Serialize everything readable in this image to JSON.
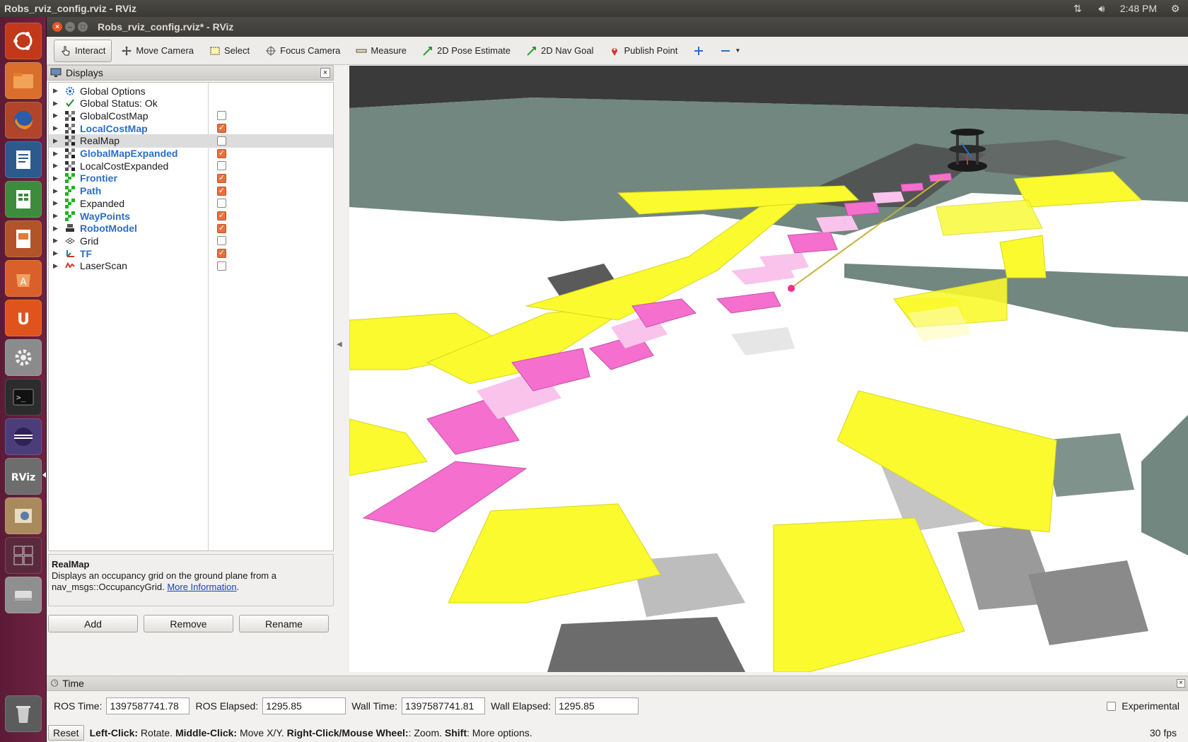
{
  "top_panel": {
    "title": "Robs_rviz_config.rviz - RViz",
    "time": "2:48 PM"
  },
  "launcher": {
    "icons": [
      "ubuntu-logo-icon",
      "files-icon",
      "firefox-icon",
      "writer-icon",
      "calc-icon",
      "impress-icon",
      "software-center-icon",
      "ubuntu-one-icon",
      "system-settings-icon",
      "terminal-icon",
      "eclipse-icon",
      "rviz-icon",
      "image-viewer-icon",
      "workspaces-icon",
      "disk-icon",
      "trash-icon"
    ]
  },
  "window": {
    "title": "Robs_rviz_config.rviz* - RViz"
  },
  "toolbar": {
    "interact": "Interact",
    "move_camera": "Move Camera",
    "select": "Select",
    "focus_camera": "Focus Camera",
    "measure": "Measure",
    "pose_estimate": "2D Pose Estimate",
    "nav_goal": "2D Nav Goal",
    "publish_point": "Publish Point"
  },
  "displays": {
    "header": "Displays",
    "items": [
      {
        "label": "Global Options",
        "icon": "gear-icon",
        "checkbox": null,
        "bold": false
      },
      {
        "label": "Global Status: Ok",
        "icon": "check-icon",
        "checkbox": null,
        "bold": false
      },
      {
        "label": "GlobalCostMap",
        "icon": "map-icon",
        "checkbox": false,
        "bold": false
      },
      {
        "label": "LocalCostMap",
        "icon": "map-icon",
        "checkbox": true,
        "bold": true
      },
      {
        "label": "RealMap",
        "icon": "map-icon",
        "checkbox": false,
        "bold": false,
        "selected": true
      },
      {
        "label": "GlobalMapExpanded",
        "icon": "map-icon",
        "checkbox": true,
        "bold": true
      },
      {
        "label": "LocalCostExpanded",
        "icon": "map-icon",
        "checkbox": false,
        "bold": false
      },
      {
        "label": "Frontier",
        "icon": "grid-cells-icon",
        "checkbox": true,
        "bold": true
      },
      {
        "label": "Path",
        "icon": "grid-cells-icon",
        "checkbox": true,
        "bold": true
      },
      {
        "label": "Expanded",
        "icon": "grid-cells-icon",
        "checkbox": false,
        "bold": false
      },
      {
        "label": "WayPoints",
        "icon": "grid-cells-icon",
        "checkbox": true,
        "bold": true
      },
      {
        "label": "RobotModel",
        "icon": "robot-icon",
        "checkbox": true,
        "bold": true
      },
      {
        "label": "Grid",
        "icon": "grid-icon",
        "checkbox": false,
        "bold": false
      },
      {
        "label": "TF",
        "icon": "axes-icon",
        "checkbox": true,
        "bold": true
      },
      {
        "label": "LaserScan",
        "icon": "laser-icon",
        "checkbox": false,
        "bold": false
      }
    ],
    "description": {
      "title": "RealMap",
      "text": "Displays an occupancy grid on the ground plane from a nav_msgs::OccupancyGrid.",
      "link": "More Information",
      "after_link": "."
    },
    "buttons": {
      "add": "Add",
      "remove": "Remove",
      "rename": "Rename"
    }
  },
  "time": {
    "header": "Time",
    "ros_time_label": "ROS Time:",
    "ros_time": "1397587741.78",
    "ros_elapsed_label": "ROS Elapsed:",
    "ros_elapsed": "1295.85",
    "wall_time_label": "Wall Time:",
    "wall_time": "1397587741.81",
    "wall_elapsed_label": "Wall Elapsed:",
    "wall_elapsed": "1295.85",
    "experimental": "Experimental"
  },
  "status": {
    "reset": "Reset",
    "left_click": "Left-Click:",
    "left_click_text": "Rotate.",
    "middle_click": "Middle-Click:",
    "middle_click_text": "Move X/Y.",
    "right_click": "Right-Click/Mouse Wheel:",
    "right_click_text": ": Zoom.",
    "shift": "Shift",
    "shift_text": ": More options.",
    "fps": "30 fps"
  },
  "colors": {
    "accent": "#e9703e",
    "costmap_yellow": "#fafa2e",
    "path_magenta": "#f56fce",
    "path_light": "#f9c3ec",
    "occupied_gray": "#71877f",
    "selected_row": "#dcdcdc"
  }
}
